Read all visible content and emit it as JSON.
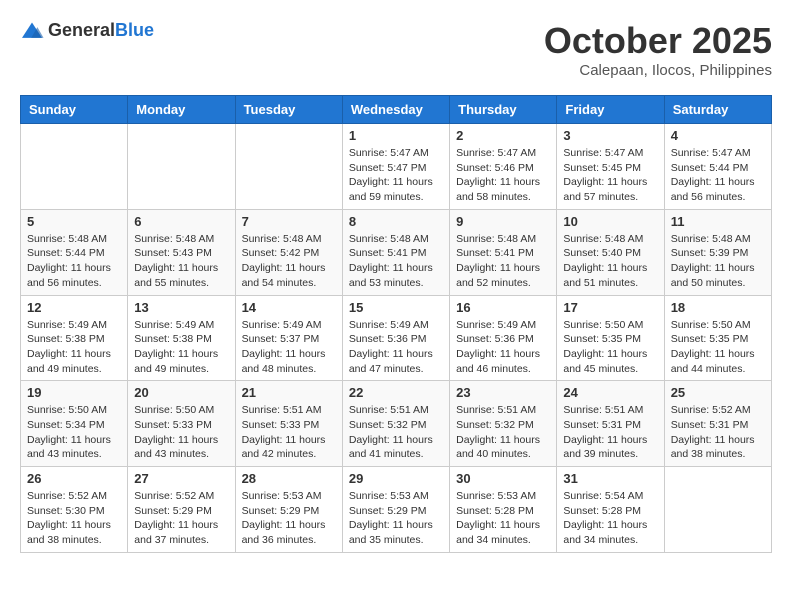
{
  "header": {
    "logo_general": "General",
    "logo_blue": "Blue",
    "month_title": "October 2025",
    "subtitle": "Calepaan, Ilocos, Philippines"
  },
  "weekdays": [
    "Sunday",
    "Monday",
    "Tuesday",
    "Wednesday",
    "Thursday",
    "Friday",
    "Saturday"
  ],
  "weeks": [
    [
      {
        "day": "",
        "info": ""
      },
      {
        "day": "",
        "info": ""
      },
      {
        "day": "",
        "info": ""
      },
      {
        "day": "1",
        "info": "Sunrise: 5:47 AM\nSunset: 5:47 PM\nDaylight: 11 hours and 59 minutes."
      },
      {
        "day": "2",
        "info": "Sunrise: 5:47 AM\nSunset: 5:46 PM\nDaylight: 11 hours and 58 minutes."
      },
      {
        "day": "3",
        "info": "Sunrise: 5:47 AM\nSunset: 5:45 PM\nDaylight: 11 hours and 57 minutes."
      },
      {
        "day": "4",
        "info": "Sunrise: 5:47 AM\nSunset: 5:44 PM\nDaylight: 11 hours and 56 minutes."
      }
    ],
    [
      {
        "day": "5",
        "info": "Sunrise: 5:48 AM\nSunset: 5:44 PM\nDaylight: 11 hours and 56 minutes."
      },
      {
        "day": "6",
        "info": "Sunrise: 5:48 AM\nSunset: 5:43 PM\nDaylight: 11 hours and 55 minutes."
      },
      {
        "day": "7",
        "info": "Sunrise: 5:48 AM\nSunset: 5:42 PM\nDaylight: 11 hours and 54 minutes."
      },
      {
        "day": "8",
        "info": "Sunrise: 5:48 AM\nSunset: 5:41 PM\nDaylight: 11 hours and 53 minutes."
      },
      {
        "day": "9",
        "info": "Sunrise: 5:48 AM\nSunset: 5:41 PM\nDaylight: 11 hours and 52 minutes."
      },
      {
        "day": "10",
        "info": "Sunrise: 5:48 AM\nSunset: 5:40 PM\nDaylight: 11 hours and 51 minutes."
      },
      {
        "day": "11",
        "info": "Sunrise: 5:48 AM\nSunset: 5:39 PM\nDaylight: 11 hours and 50 minutes."
      }
    ],
    [
      {
        "day": "12",
        "info": "Sunrise: 5:49 AM\nSunset: 5:38 PM\nDaylight: 11 hours and 49 minutes."
      },
      {
        "day": "13",
        "info": "Sunrise: 5:49 AM\nSunset: 5:38 PM\nDaylight: 11 hours and 49 minutes."
      },
      {
        "day": "14",
        "info": "Sunrise: 5:49 AM\nSunset: 5:37 PM\nDaylight: 11 hours and 48 minutes."
      },
      {
        "day": "15",
        "info": "Sunrise: 5:49 AM\nSunset: 5:36 PM\nDaylight: 11 hours and 47 minutes."
      },
      {
        "day": "16",
        "info": "Sunrise: 5:49 AM\nSunset: 5:36 PM\nDaylight: 11 hours and 46 minutes."
      },
      {
        "day": "17",
        "info": "Sunrise: 5:50 AM\nSunset: 5:35 PM\nDaylight: 11 hours and 45 minutes."
      },
      {
        "day": "18",
        "info": "Sunrise: 5:50 AM\nSunset: 5:35 PM\nDaylight: 11 hours and 44 minutes."
      }
    ],
    [
      {
        "day": "19",
        "info": "Sunrise: 5:50 AM\nSunset: 5:34 PM\nDaylight: 11 hours and 43 minutes."
      },
      {
        "day": "20",
        "info": "Sunrise: 5:50 AM\nSunset: 5:33 PM\nDaylight: 11 hours and 43 minutes."
      },
      {
        "day": "21",
        "info": "Sunrise: 5:51 AM\nSunset: 5:33 PM\nDaylight: 11 hours and 42 minutes."
      },
      {
        "day": "22",
        "info": "Sunrise: 5:51 AM\nSunset: 5:32 PM\nDaylight: 11 hours and 41 minutes."
      },
      {
        "day": "23",
        "info": "Sunrise: 5:51 AM\nSunset: 5:32 PM\nDaylight: 11 hours and 40 minutes."
      },
      {
        "day": "24",
        "info": "Sunrise: 5:51 AM\nSunset: 5:31 PM\nDaylight: 11 hours and 39 minutes."
      },
      {
        "day": "25",
        "info": "Sunrise: 5:52 AM\nSunset: 5:31 PM\nDaylight: 11 hours and 38 minutes."
      }
    ],
    [
      {
        "day": "26",
        "info": "Sunrise: 5:52 AM\nSunset: 5:30 PM\nDaylight: 11 hours and 38 minutes."
      },
      {
        "day": "27",
        "info": "Sunrise: 5:52 AM\nSunset: 5:29 PM\nDaylight: 11 hours and 37 minutes."
      },
      {
        "day": "28",
        "info": "Sunrise: 5:53 AM\nSunset: 5:29 PM\nDaylight: 11 hours and 36 minutes."
      },
      {
        "day": "29",
        "info": "Sunrise: 5:53 AM\nSunset: 5:29 PM\nDaylight: 11 hours and 35 minutes."
      },
      {
        "day": "30",
        "info": "Sunrise: 5:53 AM\nSunset: 5:28 PM\nDaylight: 11 hours and 34 minutes."
      },
      {
        "day": "31",
        "info": "Sunrise: 5:54 AM\nSunset: 5:28 PM\nDaylight: 11 hours and 34 minutes."
      },
      {
        "day": "",
        "info": ""
      }
    ]
  ]
}
